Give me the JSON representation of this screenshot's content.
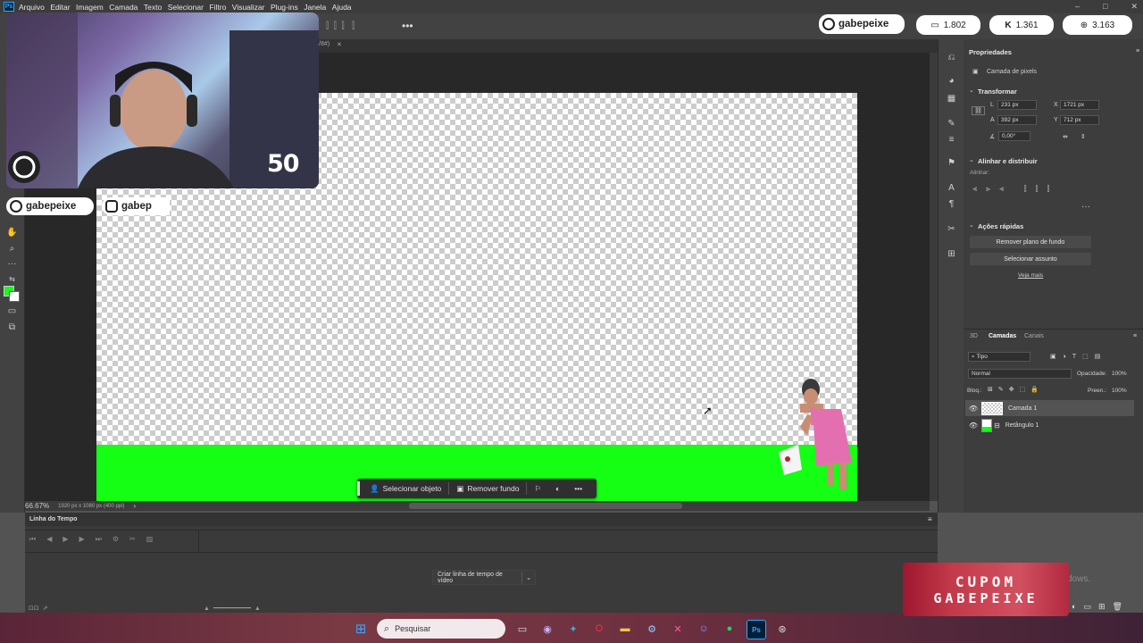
{
  "menu": {
    "items": [
      "Arquivo",
      "Editar",
      "Imagem",
      "Camada",
      "Texto",
      "Selecionar",
      "Filtro",
      "Visualizar",
      "Plug-ins",
      "Janela",
      "Ajuda"
    ]
  },
  "tab": {
    "title_fragment": "/8#)"
  },
  "canvas": {
    "zoom": "66.67%",
    "doc_size": "1920 px x 1080 px (400 ppi)",
    "checker_colors": [
      "#ffffff",
      "#cccccc"
    ],
    "green_fill": "#14ff14"
  },
  "context_bar": {
    "select_object": "Selecionar objeto",
    "remove_bg": "Remover fundo"
  },
  "properties": {
    "title": "Propriedades",
    "layer_type": "Camada de pixels",
    "transform": {
      "title": "Transformar",
      "w_label": "L",
      "w": "231 px",
      "h_label": "A",
      "h": "392 px",
      "x_label": "X",
      "x": "1721 px",
      "y_label": "Y",
      "y": "712 px",
      "angle": "0,00°"
    },
    "align": {
      "title": "Alinhar e distribuir",
      "sub": "Alinhar:"
    },
    "quick": {
      "title": "Ações rápidas",
      "remove_bg": "Remover plano de fundo",
      "select_subject": "Selecionar assunto",
      "see_more": "Veja mais"
    }
  },
  "layers_panel": {
    "tabs": [
      "3D",
      "Camadas",
      "Canais"
    ],
    "active_tab": "Camadas",
    "filter": "Tipo",
    "blend": "Normal",
    "opacity_label": "Opacidade:",
    "opacity": "100%",
    "lock_label": "Bloq.:",
    "fill_label": "Preen.:",
    "fill": "100%",
    "layers": [
      {
        "name": "Camada 1",
        "selected": true
      },
      {
        "name": "Retângulo 1",
        "selected": false
      }
    ]
  },
  "timeline": {
    "title": "Linha do Tempo",
    "create_button": "Criar linha de tempo de vídeo"
  },
  "taskbar": {
    "search_placeholder": "Pesquisar",
    "watermark": "dows."
  },
  "stream": {
    "handle": "gabepeixe",
    "handle_partial": "gabep",
    "viewer_count": "50",
    "stat_1": "1.802",
    "stat_2": "1.361",
    "stat_3": "3.163",
    "coupon_line1": "CUPOM",
    "coupon_line2": "GABEPEIXE"
  }
}
